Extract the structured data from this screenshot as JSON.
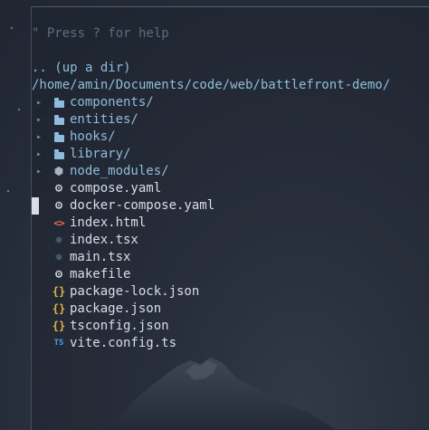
{
  "help_text": "\" Press ? for help",
  "up_dir": ".. (up a dir)",
  "cwd": "/home/amin/Documents/code/web/battlefront-demo/",
  "entries": [
    {
      "name": "components/",
      "type": "dir",
      "icon": "folder-icon"
    },
    {
      "name": "entities/",
      "type": "dir",
      "icon": "folder-icon"
    },
    {
      "name": "hooks/",
      "type": "dir",
      "icon": "folder-icon"
    },
    {
      "name": "library/",
      "type": "dir",
      "icon": "folder-icon"
    },
    {
      "name": "node_modules/",
      "type": "dir",
      "icon": "nodejs-icon"
    },
    {
      "name": "compose.yaml",
      "type": "file",
      "icon": "gear-icon"
    },
    {
      "name": "docker-compose.yaml",
      "type": "file",
      "icon": "gear-icon",
      "selected": true
    },
    {
      "name": "index.html",
      "type": "file",
      "icon": "html-icon"
    },
    {
      "name": "index.tsx",
      "type": "file",
      "icon": "react-icon"
    },
    {
      "name": "main.tsx",
      "type": "file",
      "icon": "react-icon"
    },
    {
      "name": "makefile",
      "type": "file",
      "icon": "gear-icon"
    },
    {
      "name": "package-lock.json",
      "type": "file",
      "icon": "json-icon"
    },
    {
      "name": "package.json",
      "type": "file",
      "icon": "json-icon"
    },
    {
      "name": "tsconfig.json",
      "type": "file",
      "icon": "json-icon"
    },
    {
      "name": "vite.config.ts",
      "type": "file",
      "icon": "typescript-icon"
    }
  ],
  "glyphs": {
    "arrow": "▸",
    "gear": "⚙",
    "html": "<>",
    "react": "⚛",
    "json": "{}",
    "ts": "TS",
    "node": "⬢"
  },
  "colors": {
    "dir": "#8fbcdc",
    "html": "#e8744a",
    "json": "#e3b341",
    "ts": "#4d9be0",
    "react": "#7fb8d4"
  }
}
